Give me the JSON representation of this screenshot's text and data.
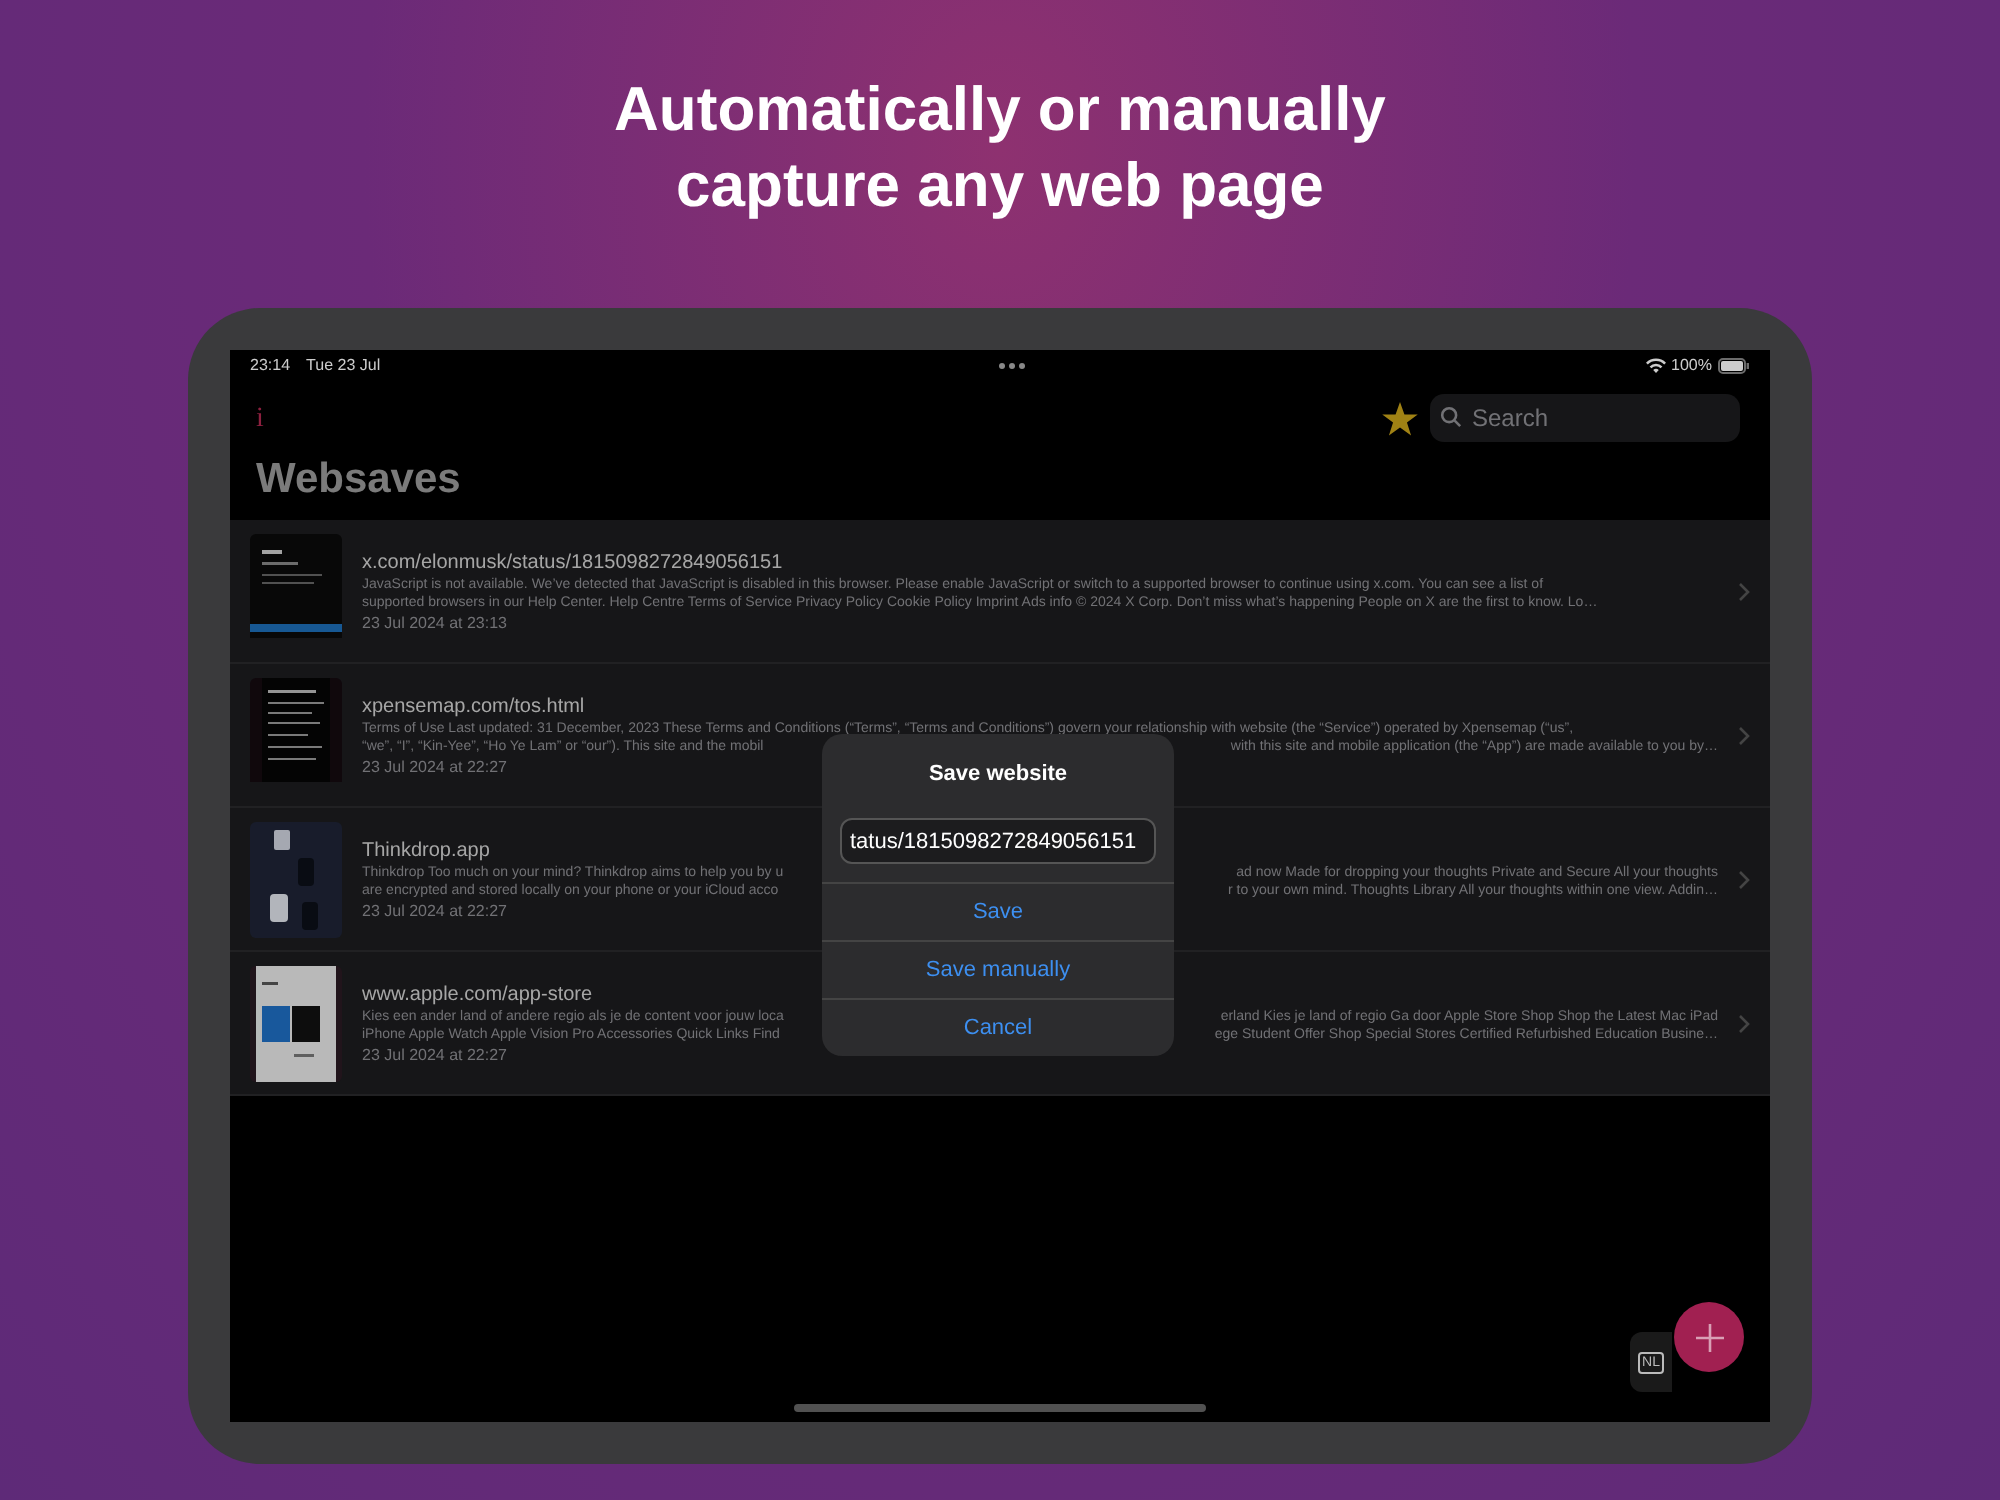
{
  "headline": [
    "Automatically or manually",
    "capture any web page"
  ],
  "status_bar": {
    "time": "23:14",
    "date": "Tue 23 Jul",
    "battery": "100%"
  },
  "toolbar": {
    "info": "i",
    "search": {
      "placeholder": "Search"
    }
  },
  "title": "Websaves",
  "items": [
    {
      "url": "x.com/elonmusk/status/1815098272849056151",
      "snippet": [
        {
          "left": "JavaScript is not available. We’ve detected that JavaScript is disabled in this browser. Please enable JavaScript or switch to a supported browser to continue using x.com. You can see a list of"
        },
        {
          "left": "supported browsers in our Help Center. Help Centre Terms of Service Privacy Policy Cookie Policy Imprint Ads info © 2024 X Corp. Don’t miss what’s happening People on X are the first to know. Lo…"
        }
      ],
      "date": "23 Jul 2024 at 23:13"
    },
    {
      "url": "xpensemap.com/tos.html",
      "snippet": [
        {
          "left": "Terms of Use Last updated: 31 December, 2023 These Terms and Conditions (“Terms”, “Terms and Conditions”) govern your relationship with website (the “Service”) operated by Xpensemap (“us”,"
        },
        {
          "left": "“we”, “I”, “Kin-Yee”, “Ho Ye Lam” or “our”). This site and the mobil",
          "right": "with this site and mobile application (the “App”) are made available to you by…"
        }
      ],
      "date": "23 Jul 2024 at 22:27"
    },
    {
      "url": "Thinkdrop.app",
      "snippet": [
        {
          "left": "Thinkdrop Too much on your mind? Thinkdrop aims to help you by u",
          "right": "ad now Made for dropping your thoughts Private and Secure All your thoughts"
        },
        {
          "left": "are encrypted and stored locally on your phone or your iCloud acco",
          "right": "r to your own mind. Thoughts Library All your thoughts within one view. Addin…"
        }
      ],
      "date": "23 Jul 2024 at 22:27"
    },
    {
      "url": "www.apple.com/app-store",
      "snippet": [
        {
          "left": "Kies een ander land of andere regio als je de content voor jouw loca",
          "right": "erland Kies je land of regio Ga door Apple Store Shop Shop the Latest Mac iPad"
        },
        {
          "left": "iPhone Apple Watch Apple Vision Pro Accessories Quick Links Find",
          "right": "ege Student Offer Shop Special Stores Certified Refurbished Education Busine…"
        }
      ],
      "date": "23 Jul 2024 at 22:27"
    }
  ],
  "dialog": {
    "title": "Save website",
    "value": "tatus/1815098272849056151",
    "buttons": [
      "Save",
      "Save manually",
      "Cancel"
    ]
  },
  "keyboard_key": "NL"
}
